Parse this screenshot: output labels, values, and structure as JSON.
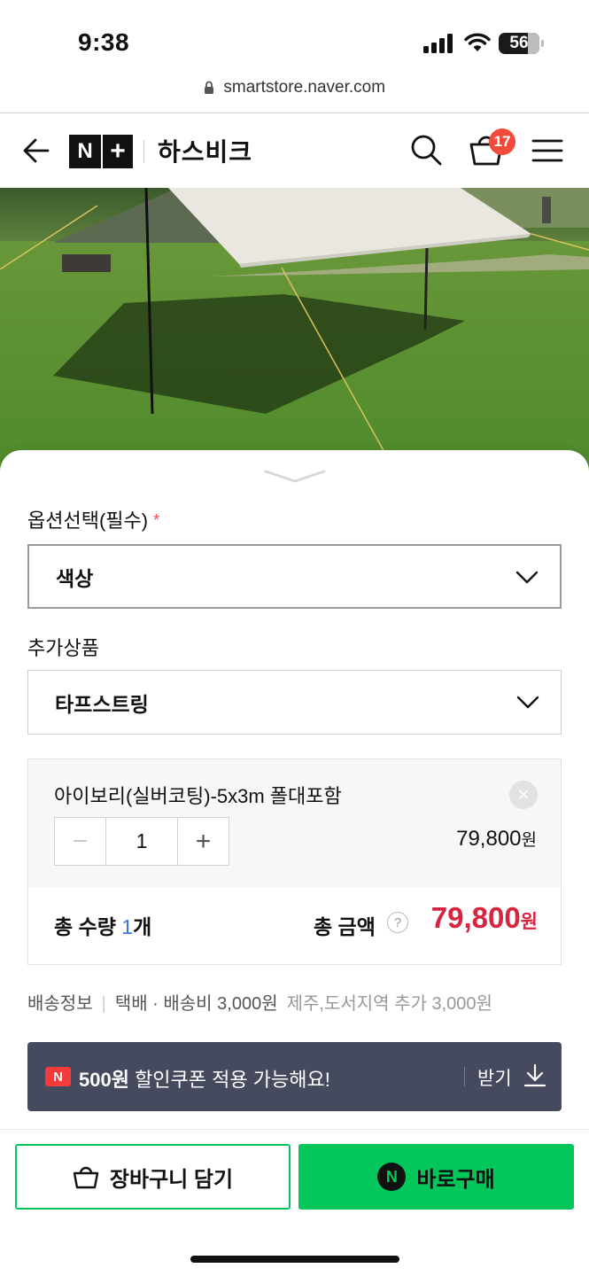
{
  "status_bar": {
    "time": "9:38",
    "battery": "56"
  },
  "browser": {
    "url": "smartstore.naver.com"
  },
  "header": {
    "logo_n": "N",
    "logo_plus": "+",
    "store_name": "하스비크",
    "cart_count": "17"
  },
  "options": {
    "required_label": "옵션선택(필수)",
    "required_mark": "*",
    "color_select_value": "색상",
    "extra_label": "추가상품",
    "extra_select_value": "타프스트링"
  },
  "selected_item": {
    "name": "아이보리(실버코팅)-5x3m 폴대포함",
    "remove_icon": "×",
    "quantity": "1",
    "minus": "−",
    "plus": "+",
    "price": "79,800",
    "currency": "원"
  },
  "totals": {
    "qty_prefix": "총 수량 ",
    "qty_value": "1",
    "qty_suffix": "개",
    "amount_label": "총 금액",
    "help_icon": "?",
    "amount": "79,800",
    "currency": "원"
  },
  "delivery": {
    "label": "배송정보",
    "info": "택배 · 배송비 3,000원",
    "extra": "제주,도서지역 추가 3,000원"
  },
  "coupon": {
    "logo": "N",
    "amount": "500원",
    "message": " 할인쿠폰 적용 가능해요!",
    "action": "받기"
  },
  "actions": {
    "cart_button": "장바구니 담기",
    "buy_logo": "N",
    "buy_button": "바로구매"
  },
  "colors": {
    "naver_green": "#03c75a",
    "price_red": "#d7243f",
    "coupon_bg": "#454a5e",
    "badge_red": "#f24b3b"
  }
}
